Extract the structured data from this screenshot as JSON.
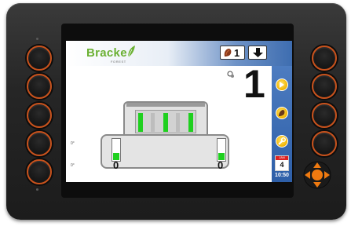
{
  "header": {
    "logo": "Bracke",
    "logo_sub": "FOREST",
    "counter": "1"
  },
  "main": {
    "big_value": "1",
    "left_wheel_value": "0",
    "right_wheel_value": "0",
    "left_indicator_top": "0°",
    "left_indicator_bottom": "0°",
    "left_pod_level": 0.35,
    "right_pod_level": 0.35
  },
  "sidebar": {
    "calendar_month": "JAN",
    "calendar_day": "4",
    "time": "10:50"
  },
  "icons": {
    "brush": "stump-brush-icon",
    "arrow": "down-arrow-icon",
    "next": "forward-icon",
    "stump": "stump-icon",
    "wrench": "wrench-icon",
    "target": "sensor-icon",
    "dpad": "directional-pad-icon"
  },
  "colors": {
    "accent_green": "#1fd01f",
    "button_ring": "#c9521c",
    "sidebar_blue": "#2e5fa8",
    "logo_green": "#6ab032"
  }
}
